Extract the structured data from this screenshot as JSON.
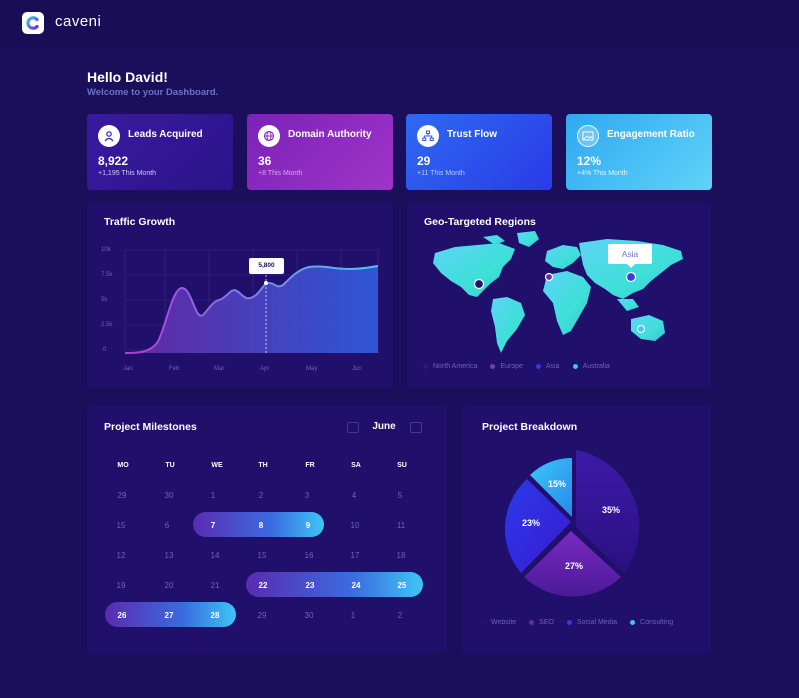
{
  "app": {
    "name": "caveni"
  },
  "greeting": {
    "title": "Hello David!",
    "subtitle": "Welcome to your Dashboard."
  },
  "stats": [
    {
      "title": "Leads Acquired",
      "value": "8,922",
      "sub": "+1,195 This Month",
      "icon": "user-icon"
    },
    {
      "title": "Domain Authority",
      "value": "36",
      "sub": "+8 This Month",
      "icon": "globe-icon"
    },
    {
      "title": "Trust Flow",
      "value": "29",
      "sub": "+11 This Month",
      "icon": "sitemap-icon"
    },
    {
      "title": "Engagement Ratio",
      "value": "12%",
      "sub": "+4% This Month",
      "icon": "image-icon"
    }
  ],
  "traffic": {
    "title": "Traffic Growth",
    "tooltip": "5,800",
    "y_ticks": [
      "10k",
      "7.5k",
      "5k",
      "2.5k",
      "0"
    ],
    "x_ticks": [
      "Jan",
      "Feb",
      "Mar",
      "Apr",
      "May",
      "Jun"
    ]
  },
  "chart_data": {
    "type": "area",
    "title": "Traffic Growth",
    "categories": [
      "Jan",
      "Feb",
      "Mar",
      "Apr",
      "May",
      "Jun"
    ],
    "ylim": [
      0,
      10000
    ],
    "highlight": {
      "x": "Apr",
      "y": 5800,
      "label": "5,800"
    },
    "grid": true
  },
  "geo": {
    "title": "Geo-Targeted Regions",
    "callout": "Asia",
    "legend": [
      {
        "label": "North America",
        "color": "#2a1a7a"
      },
      {
        "label": "Europe",
        "color": "#7a3bb8"
      },
      {
        "label": "Asia",
        "color": "#3a3ae0"
      },
      {
        "label": "Australia",
        "color": "#3ec5f5"
      }
    ]
  },
  "milestones": {
    "title": "Project Milestones",
    "month": "June",
    "weekdays": [
      "MO",
      "TU",
      "WE",
      "TH",
      "FR",
      "SA",
      "SU"
    ],
    "weeks": [
      [
        "29",
        "30",
        "1",
        "2",
        "3",
        "4",
        "5"
      ],
      [
        "15",
        "6",
        "7",
        "8",
        "9",
        "10",
        "11"
      ],
      [
        "12",
        "13",
        "14",
        "15",
        "16",
        "17",
        "18"
      ],
      [
        "19",
        "20",
        "21",
        "22",
        "23",
        "24",
        "25"
      ],
      [
        "26",
        "27",
        "28",
        "29",
        "30",
        "1",
        "2"
      ]
    ],
    "selected_ranges": [
      {
        "label": "7 – 9"
      },
      {
        "label": "22 – 25"
      },
      {
        "label": "26 – 28"
      }
    ]
  },
  "breakdown": {
    "title": "Project Breakdown",
    "slices": [
      {
        "label": "Website",
        "value": 35,
        "text": "35%",
        "color": "#3a1a9a"
      },
      {
        "label": "SEO",
        "value": 27,
        "text": "27%",
        "color": "#6a2aa8"
      },
      {
        "label": "Social Media",
        "value": 23,
        "text": "23%",
        "color": "#3a2ce0"
      },
      {
        "label": "Consulting",
        "value": 15,
        "text": "15%",
        "color": "#2bb5ef"
      }
    ],
    "legend": [
      {
        "label": "Website",
        "color": "#24126e"
      },
      {
        "label": "SEO",
        "color": "#6a2aa8"
      },
      {
        "label": "Social Media",
        "color": "#3a3ae0"
      },
      {
        "label": "Consulting",
        "color": "#3ec5f5"
      }
    ]
  }
}
